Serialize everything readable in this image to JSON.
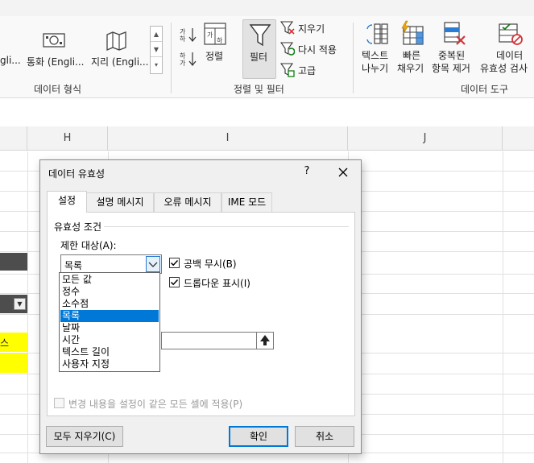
{
  "ribbon": {
    "data_types": {
      "items": [
        {
          "label": "gli...",
          "icon": "stocks-icon"
        },
        {
          "label": "통화 (Engli...",
          "icon": "currency-icon"
        },
        {
          "label": "지리 (Engli...",
          "icon": "map-icon"
        }
      ],
      "group_label": "데이터 형식"
    },
    "sort_filter": {
      "sort_label": "정렬",
      "filter_label": "필터",
      "clear_label": "지우기",
      "reapply_label": "다시 적용",
      "advanced_label": "고급",
      "group_label": "정렬 및 필터"
    },
    "data_tools": {
      "text_to_columns": [
        "텍스트",
        "나누기"
      ],
      "flash_fill": [
        "빠른",
        "채우기"
      ],
      "remove_duplicates": [
        "중복된",
        "항목 제거"
      ],
      "data_validation": [
        "데이터",
        "유효성 검사"
      ],
      "group_label": "데이터 도구"
    }
  },
  "sheet": {
    "columns": [
      "H",
      "I",
      "J"
    ],
    "visible_cell_text": "스",
    "colors": {
      "header_dark": "#4d4d4d",
      "highlight": "#ffff00"
    }
  },
  "dialog": {
    "title": "데이터 유효성",
    "help": "?",
    "tabs": [
      "설정",
      "설명 메시지",
      "오류 메시지",
      "IME 모드"
    ],
    "active_tab": 0,
    "group_title": "유효성 조건",
    "allow_label": "제한 대상(A):",
    "allow_value": "목록",
    "ignore_blank_label": "공백 무시(B)",
    "ignore_blank_checked": true,
    "in_cell_dropdown_label": "드롭다운 표시(I)",
    "in_cell_dropdown_checked": true,
    "dropdown_options": [
      "모든 값",
      "정수",
      "소수점",
      "목록",
      "날짜",
      "시간",
      "텍스트 길이",
      "사용자 지정"
    ],
    "selected_option_index": 3,
    "apply_all_label": "변경 내용을 설정이 같은 모든 셀에 적용(P)",
    "apply_all_checked": false,
    "clear_all_label": "모두 지우기(C)",
    "ok_label": "확인",
    "cancel_label": "취소",
    "accent_color": "#0078d7"
  }
}
